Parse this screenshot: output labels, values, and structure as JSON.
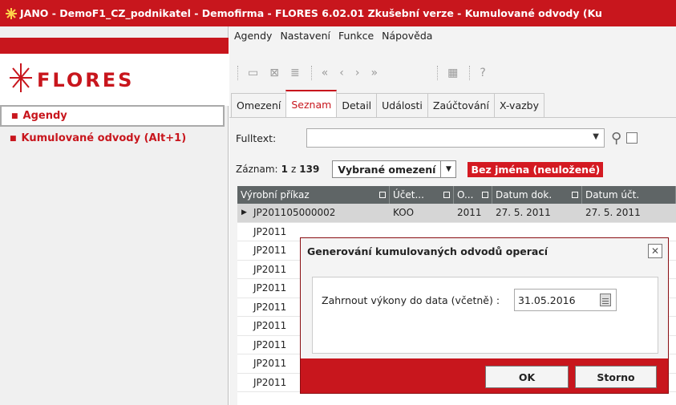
{
  "window": {
    "title": "JANO - DemoF1_CZ_podnikatel - Demofirma - FLORES 6.02.01 Zkušební verze - Kumulované odvody (Ku"
  },
  "colors": {
    "brand_red": "#c8161d",
    "grid_header": "#5f6566"
  },
  "sidebar": {
    "logo": "FLORES",
    "items": [
      {
        "label": "Agendy",
        "icon": "square-bullet-icon"
      },
      {
        "label": "Kumulované odvody (Alt+1)",
        "icon": "arrow-bullet-icon"
      }
    ]
  },
  "menubar": {
    "items": [
      "Agendy",
      "Nastavení",
      "Funkce",
      "Nápověda"
    ]
  },
  "toolbar": {
    "icons": [
      "folder-icon",
      "close-doc-icon",
      "list-icon",
      "first-icon",
      "prev-icon",
      "next-icon",
      "last-icon",
      "grid-icon",
      "help-icon"
    ]
  },
  "tabs": [
    {
      "label": "Omezení",
      "active": false
    },
    {
      "label": "Seznam",
      "active": true
    },
    {
      "label": "Detail",
      "active": false
    },
    {
      "label": "Události",
      "active": false
    },
    {
      "label": "Zaúčtování",
      "active": false
    },
    {
      "label": "X-vazby",
      "active": false
    }
  ],
  "search": {
    "label": "Fulltext:",
    "value": ""
  },
  "records": {
    "prefix": "Záznam:",
    "current": "1",
    "of": "z",
    "total": "139",
    "filter": "Vybrané omezení",
    "name_badge": "Bez jména (neuložené)"
  },
  "grid": {
    "columns": [
      "Výrobní příkaz",
      "Účet...",
      "O...",
      "Datum dok.",
      "Datum účt."
    ],
    "rows": [
      [
        "JP201105000002",
        "KOO",
        "2011",
        "27. 5. 2011",
        "27. 5. 2011"
      ],
      [
        "JP2011",
        "",
        "",
        "",
        ""
      ],
      [
        "JP2011",
        "",
        "",
        "",
        ""
      ],
      [
        "JP2011",
        "",
        "",
        "",
        ""
      ],
      [
        "JP2011",
        "",
        "",
        "",
        ""
      ],
      [
        "JP2011",
        "",
        "",
        "",
        ""
      ],
      [
        "JP2011",
        "",
        "",
        "",
        ""
      ],
      [
        "JP2011",
        "",
        "",
        "",
        ""
      ],
      [
        "JP2011",
        "",
        "",
        "",
        ""
      ],
      [
        "JP2011",
        "",
        "",
        "",
        ""
      ]
    ]
  },
  "dialog": {
    "title": "Generování kumulovaných odvodů operací",
    "field_label": "Zahrnout výkony do data (včetně) :",
    "field_value": "31.05.2016",
    "ok_label": "OK",
    "cancel_label": "Storno"
  }
}
